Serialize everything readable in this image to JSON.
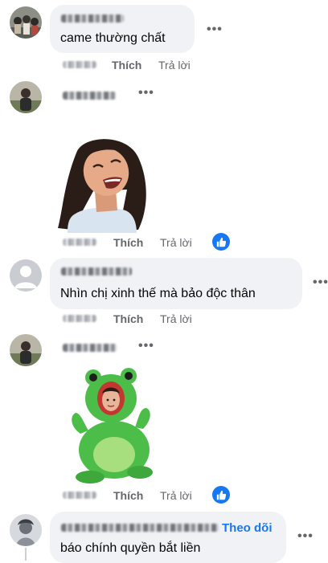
{
  "comments": [
    {
      "text": "came thường chất",
      "actions": {
        "like": "Thích",
        "reply": "Trả lời"
      },
      "more": "•••"
    },
    {
      "sticker": "laughing-woman-avatar-sticker",
      "actions": {
        "like": "Thích",
        "reply": "Trả lời"
      },
      "more": "•••",
      "reaction": "like"
    },
    {
      "text": "Nhìn chị xinh thế mà bảo độc thân",
      "actions": {
        "like": "Thích",
        "reply": "Trả lời"
      },
      "more": "•••"
    },
    {
      "sticker": "frog-costume-avatar-sticker",
      "actions": {
        "like": "Thích",
        "reply": "Trả lời"
      },
      "more": "•••",
      "reaction": "like"
    },
    {
      "text": "báo chính quyền bắt liền",
      "follow": "Theo dõi",
      "more": "•••"
    }
  ],
  "colors": {
    "bubble": "#f0f2f5",
    "action_text": "#65676b",
    "accent": "#1877f2"
  }
}
